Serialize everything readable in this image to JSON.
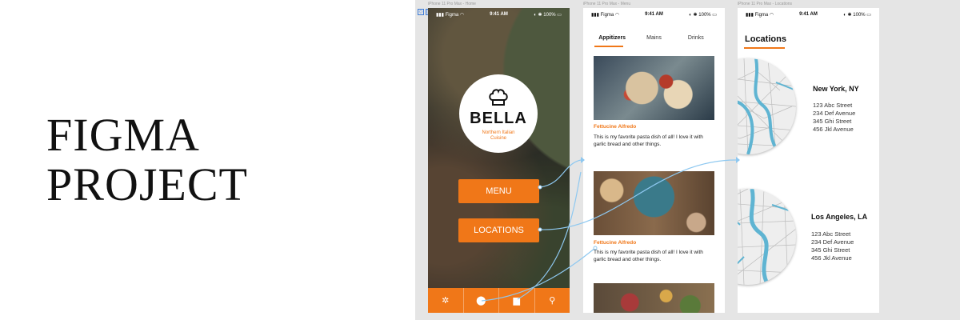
{
  "title": {
    "line1": "FIGMA",
    "line2": "PROJECT"
  },
  "frames": {
    "home_label": "iPhone 11 Pro Max - Home",
    "menu_label": "iPhone 11 Pro Max - Menu",
    "locations_label": "iPhone 11 Pro Max - Locations"
  },
  "status_bar": {
    "carrier": "Figma",
    "time": "9:41 AM",
    "battery": "100%"
  },
  "home": {
    "brand": "BELLA",
    "tagline": "Northern Italian Cuisine",
    "menu_button": "MENU",
    "locations_button": "LOCATIONS",
    "tabbar_icons": [
      "gear-icon",
      "map-pin-icon",
      "bookmark-icon",
      "search-icon"
    ]
  },
  "menu": {
    "tabs": [
      "Appitizers",
      "Mains",
      "Drinks"
    ],
    "active_tab": "Appitizers",
    "dishes": [
      {
        "name": "Fettucine Alfredo",
        "description": "This is my favorite pasta dish of all! I love it with garlic bread and other things."
      },
      {
        "name": "Fettucine Alfredo",
        "description": "This is my favorite pasta dish of all! I love it with garlic bread and other things."
      }
    ]
  },
  "locations": {
    "title": "Locations",
    "places": [
      {
        "city": "New York, NY",
        "addresses": [
          "123 Abc Street",
          "234 Def Avenue",
          "345 Ghi Street",
          "456 Jkl Avenue"
        ]
      },
      {
        "city": "Los Angeles, LA",
        "addresses": [
          "123 Abc Street",
          "234 Def Avenue",
          "345 Ghi Street",
          "456 Jkl Avenue"
        ]
      }
    ]
  },
  "colors": {
    "accent": "#f07718",
    "canvas": "#e5e5e5",
    "map_water": "#5fb4d2",
    "connector": "#8ec8f0"
  }
}
